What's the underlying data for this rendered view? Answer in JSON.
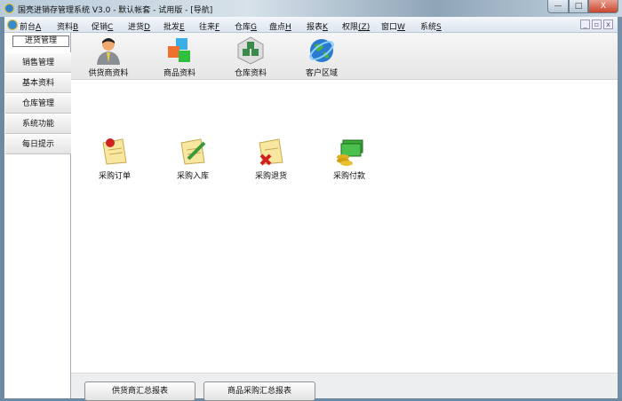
{
  "window": {
    "title": "国亮进销存管理系统 V3.0 - 默认帐套 - 试用版 - [导航]",
    "min": "—",
    "max": "□",
    "close": "X"
  },
  "menu": [
    {
      "label": "前台",
      "key": "A"
    },
    {
      "label": "资料",
      "key": "B"
    },
    {
      "label": "促销",
      "key": "C"
    },
    {
      "label": "进货",
      "key": "D"
    },
    {
      "label": "批发",
      "key": "E"
    },
    {
      "label": "往来",
      "key": "F"
    },
    {
      "label": "仓库",
      "key": "G"
    },
    {
      "label": "盘点",
      "key": "H"
    },
    {
      "label": "报表",
      "key": "K"
    },
    {
      "label": "权限",
      "key": "(Z)"
    },
    {
      "label": "窗口",
      "key": "W"
    },
    {
      "label": "系统",
      "key": "S"
    }
  ],
  "mdi": {
    "min": "_",
    "restore": "▫",
    "close": "x"
  },
  "sidebar": [
    "进货管理",
    "销售管理",
    "基本资料",
    "仓库管理",
    "系统功能",
    "每日提示"
  ],
  "toolbar": [
    "供货商资料",
    "商品资料",
    "仓库资料",
    "客户区域"
  ],
  "operations": [
    "采购订单",
    "采购入库",
    "采购退货",
    "采购付款"
  ],
  "reports": [
    "供货商汇总报表",
    "商品采购汇总报表"
  ]
}
